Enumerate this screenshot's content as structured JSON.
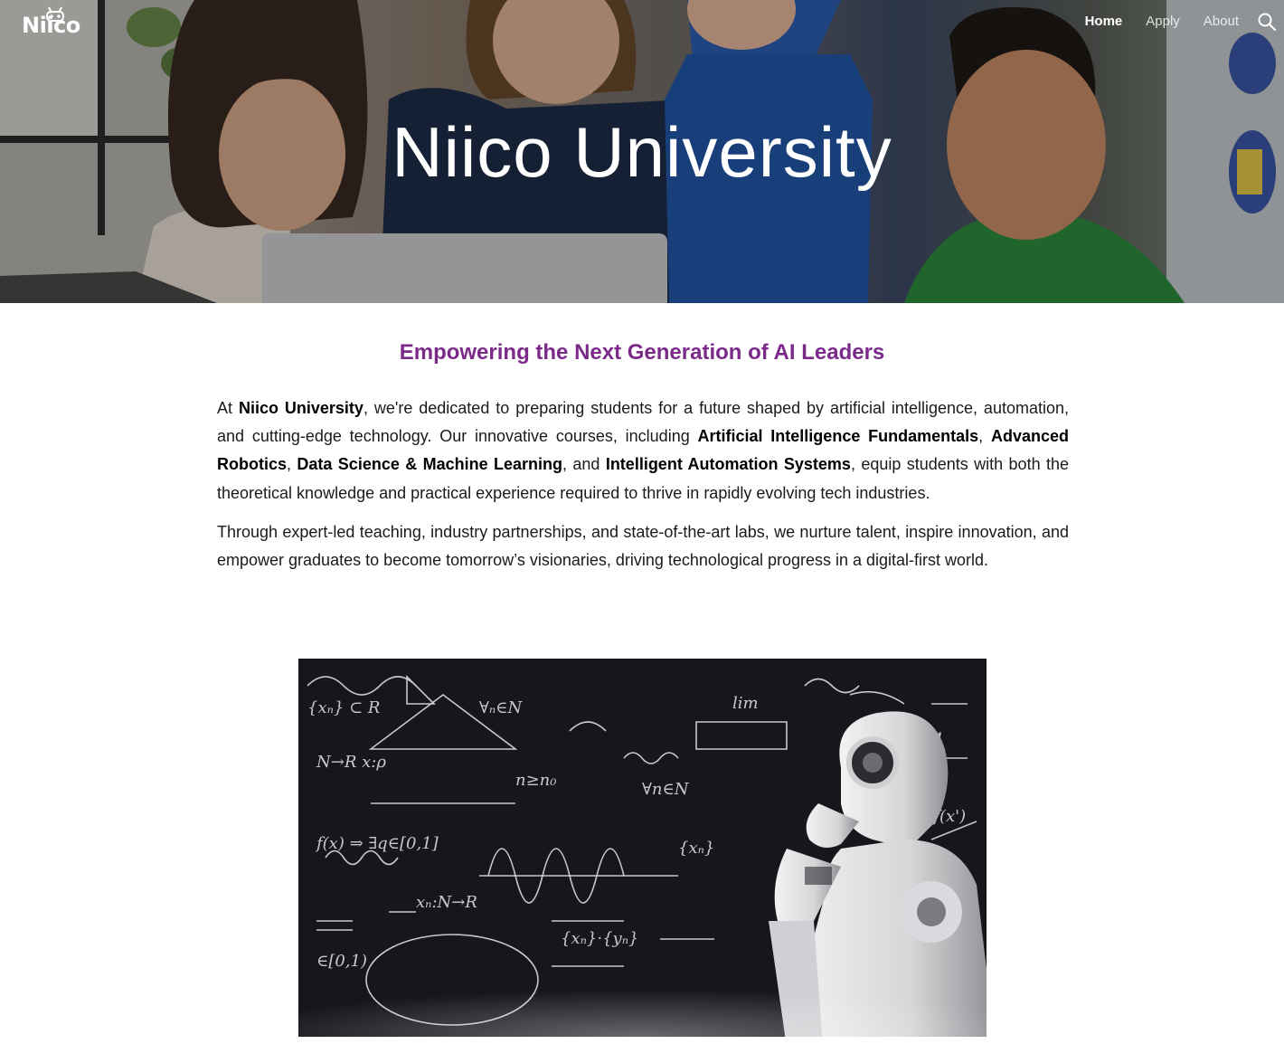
{
  "brand": {
    "logo_text": "Niico"
  },
  "nav": {
    "items": [
      {
        "label": "Home",
        "active": true
      },
      {
        "label": "Apply",
        "active": false
      },
      {
        "label": "About",
        "active": false
      }
    ],
    "search_icon": "search-icon"
  },
  "hero": {
    "title": "Niico University"
  },
  "main": {
    "heading": "Empowering the Next Generation of AI Leaders",
    "p1": {
      "t1": "At ",
      "b1": "Niico University",
      "t2": ", we're dedicated to preparing students for a future shaped by artificial intelligence, automation, and cutting-edge technology. Our innovative courses, including ",
      "b2": "Artificial Intelligence Fundamentals",
      "t3": ", ",
      "b3": "Advanced Robotics",
      "t4": ", ",
      "b4": "Data Science & Machine Learning",
      "t5": ", and ",
      "b5": "Intelligent Automation Systems",
      "t6": ", equip students with both the theoretical knowledge and practical experience required to thrive in rapidly evolving tech industries."
    },
    "p2": "Through expert-led teaching, industry partnerships, and state-of-the-art labs, we nurture talent, inspire innovation, and empower graduates to become tomorrow’s visionaries, driving technological progress in a digital-first world."
  },
  "colors": {
    "heading": "#7b2a8a",
    "nav_text": "#ffffff",
    "body_text": "#1a1a1a"
  }
}
